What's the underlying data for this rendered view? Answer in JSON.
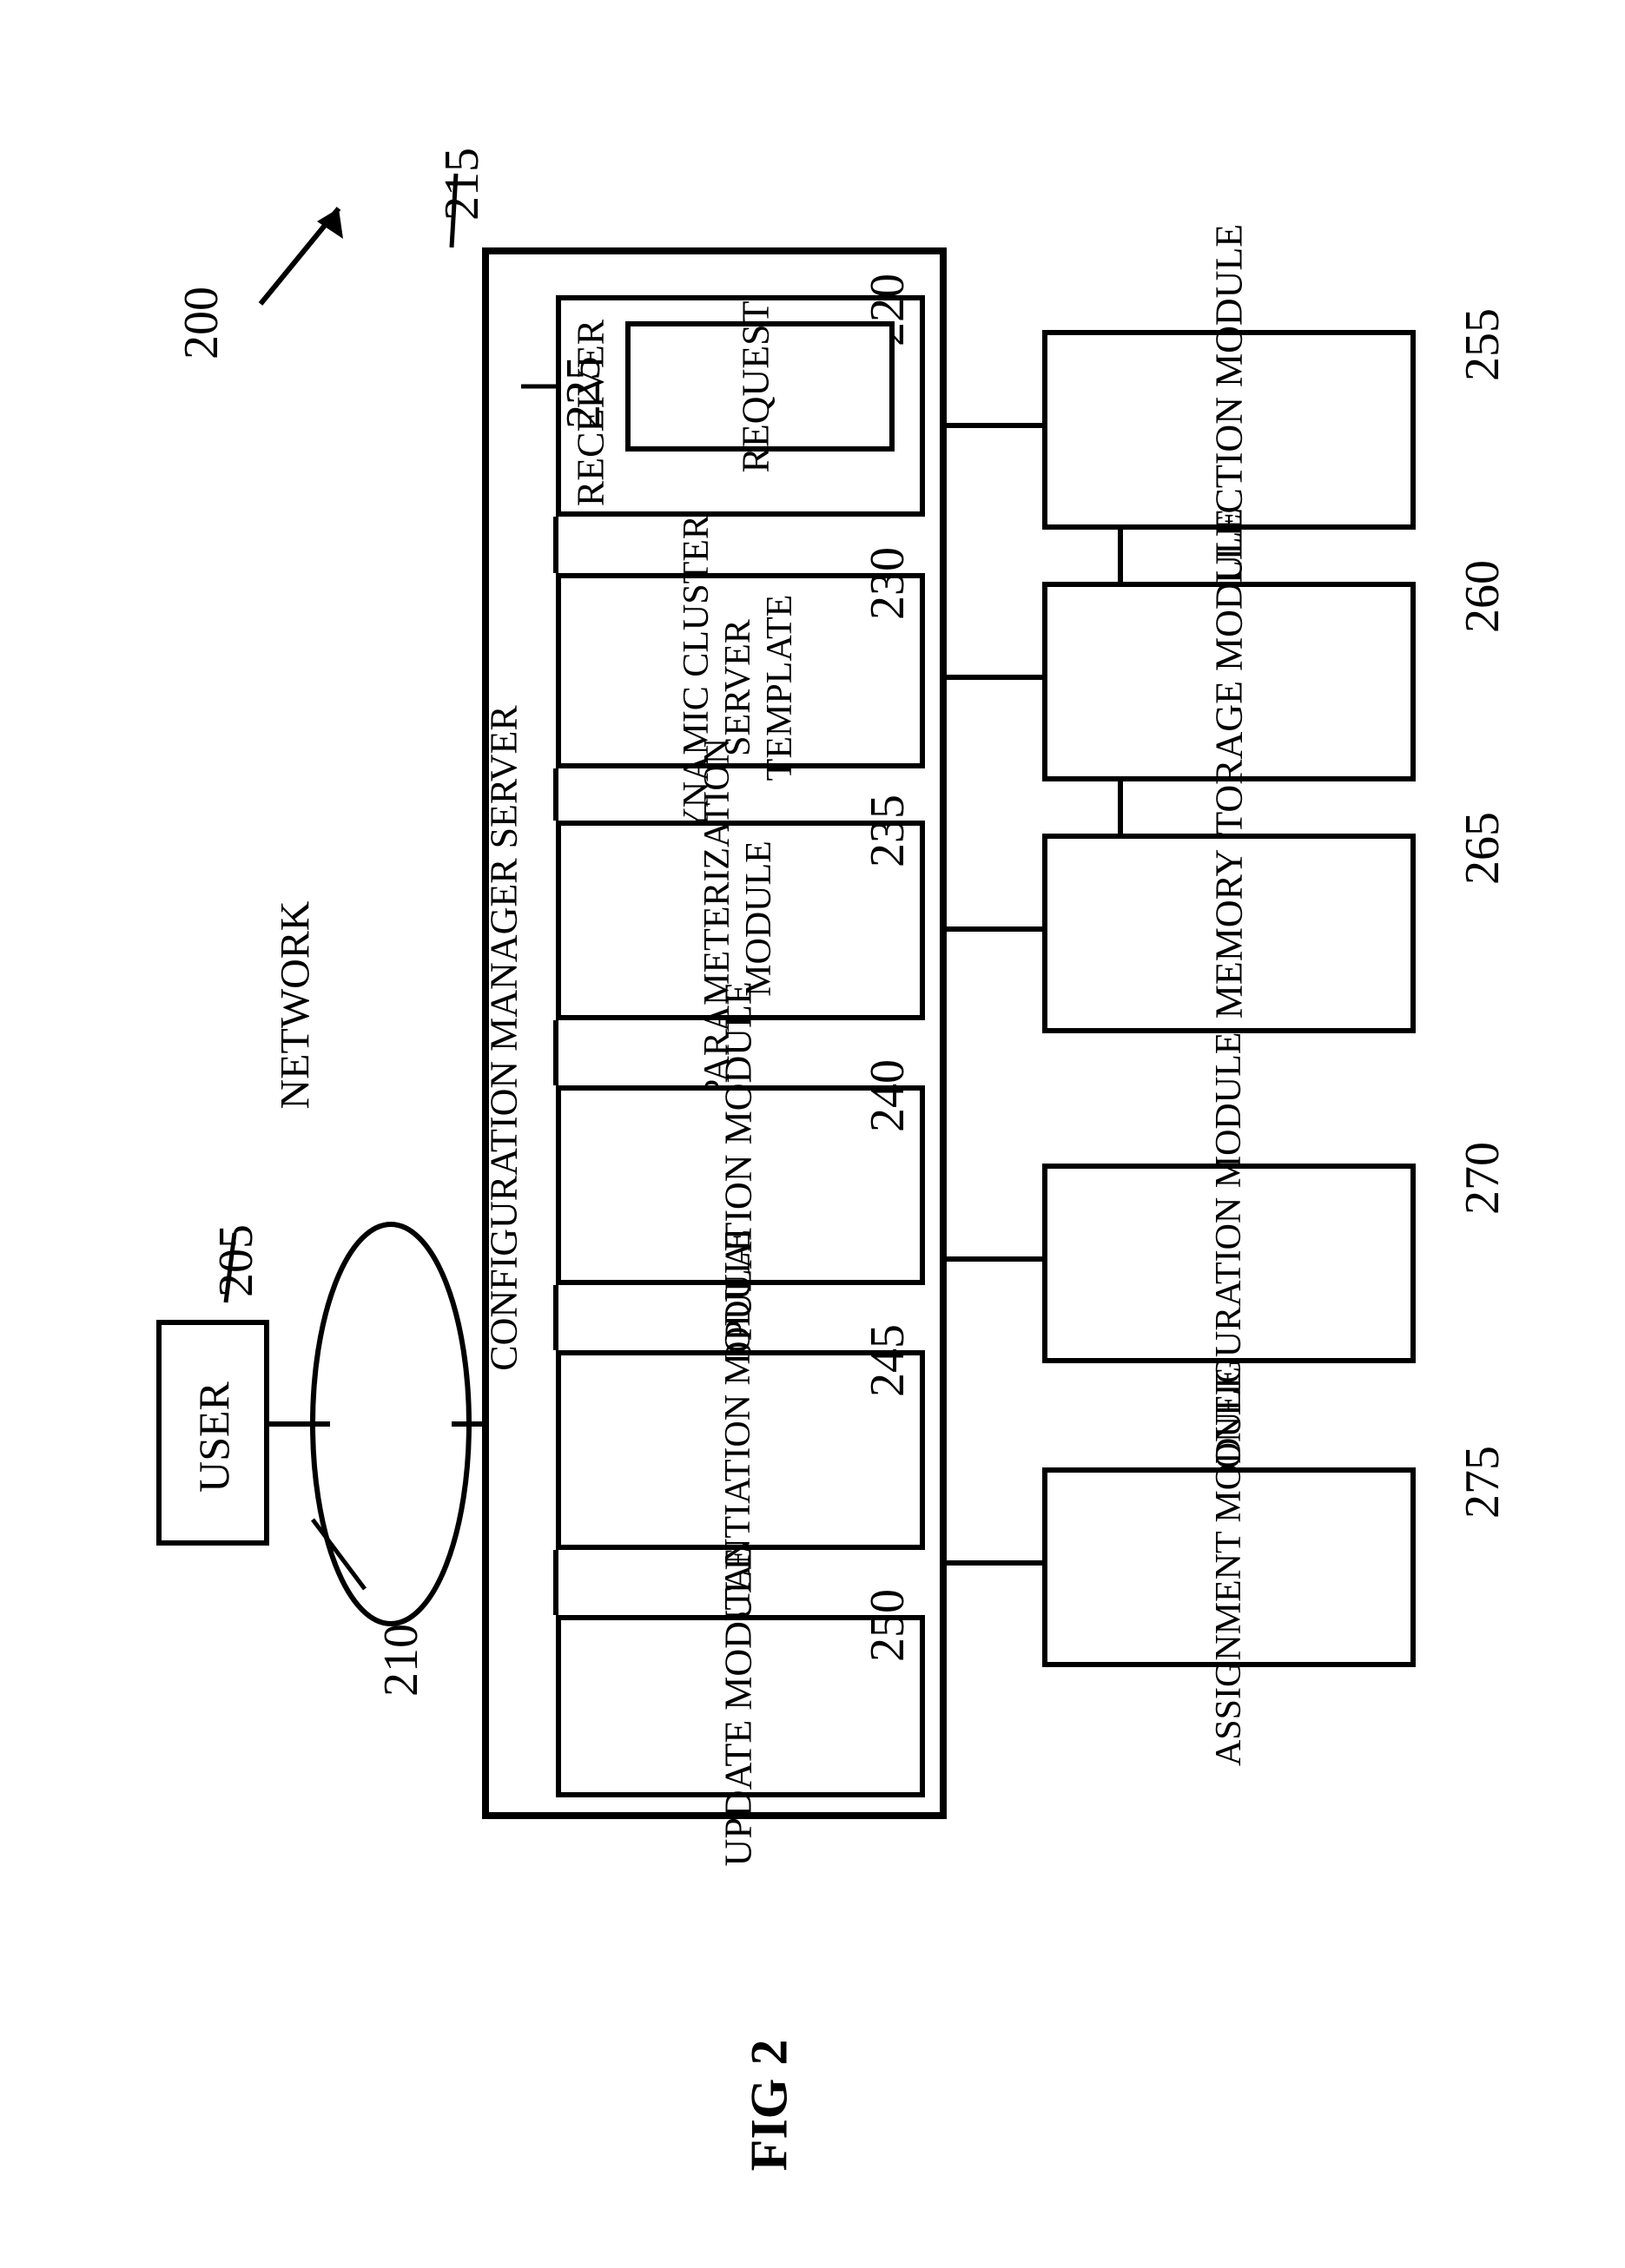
{
  "figure_ref": "200",
  "figure_label": "FIG 2",
  "network": {
    "label": "NETWORK",
    "ref": "210"
  },
  "user": {
    "label": "USER",
    "ref": "205"
  },
  "server": {
    "title": "CONFIGURATION MANAGER SERVER",
    "ref": "215",
    "receiver": {
      "label": "RECEIVER",
      "ref": "220",
      "request": {
        "label": "REQUEST",
        "ref": "225"
      }
    },
    "modules": [
      {
        "label": "DYNAMIC CLUSTER SERVER\nTEMPLATE",
        "ref": "230"
      },
      {
        "label": "PARAMETERIZATION\nMODULE",
        "ref": "235"
      },
      {
        "label": "POPULATION MODULE",
        "ref": "240"
      },
      {
        "label": "INSTANTIATION MODULE",
        "ref": "245"
      },
      {
        "label": "UPDATE MODULE",
        "ref": "250"
      }
    ]
  },
  "right_modules": [
    {
      "label": "COLLECTION MODULE",
      "ref": "255"
    },
    {
      "label": "STORAGE MODULE",
      "ref": "260"
    },
    {
      "label": "MEMORY",
      "ref": "265"
    },
    {
      "label": "CONFIGURATION MODULE",
      "ref": "270"
    },
    {
      "label": "ASSIGNMENT MODULE",
      "ref": "275"
    }
  ]
}
